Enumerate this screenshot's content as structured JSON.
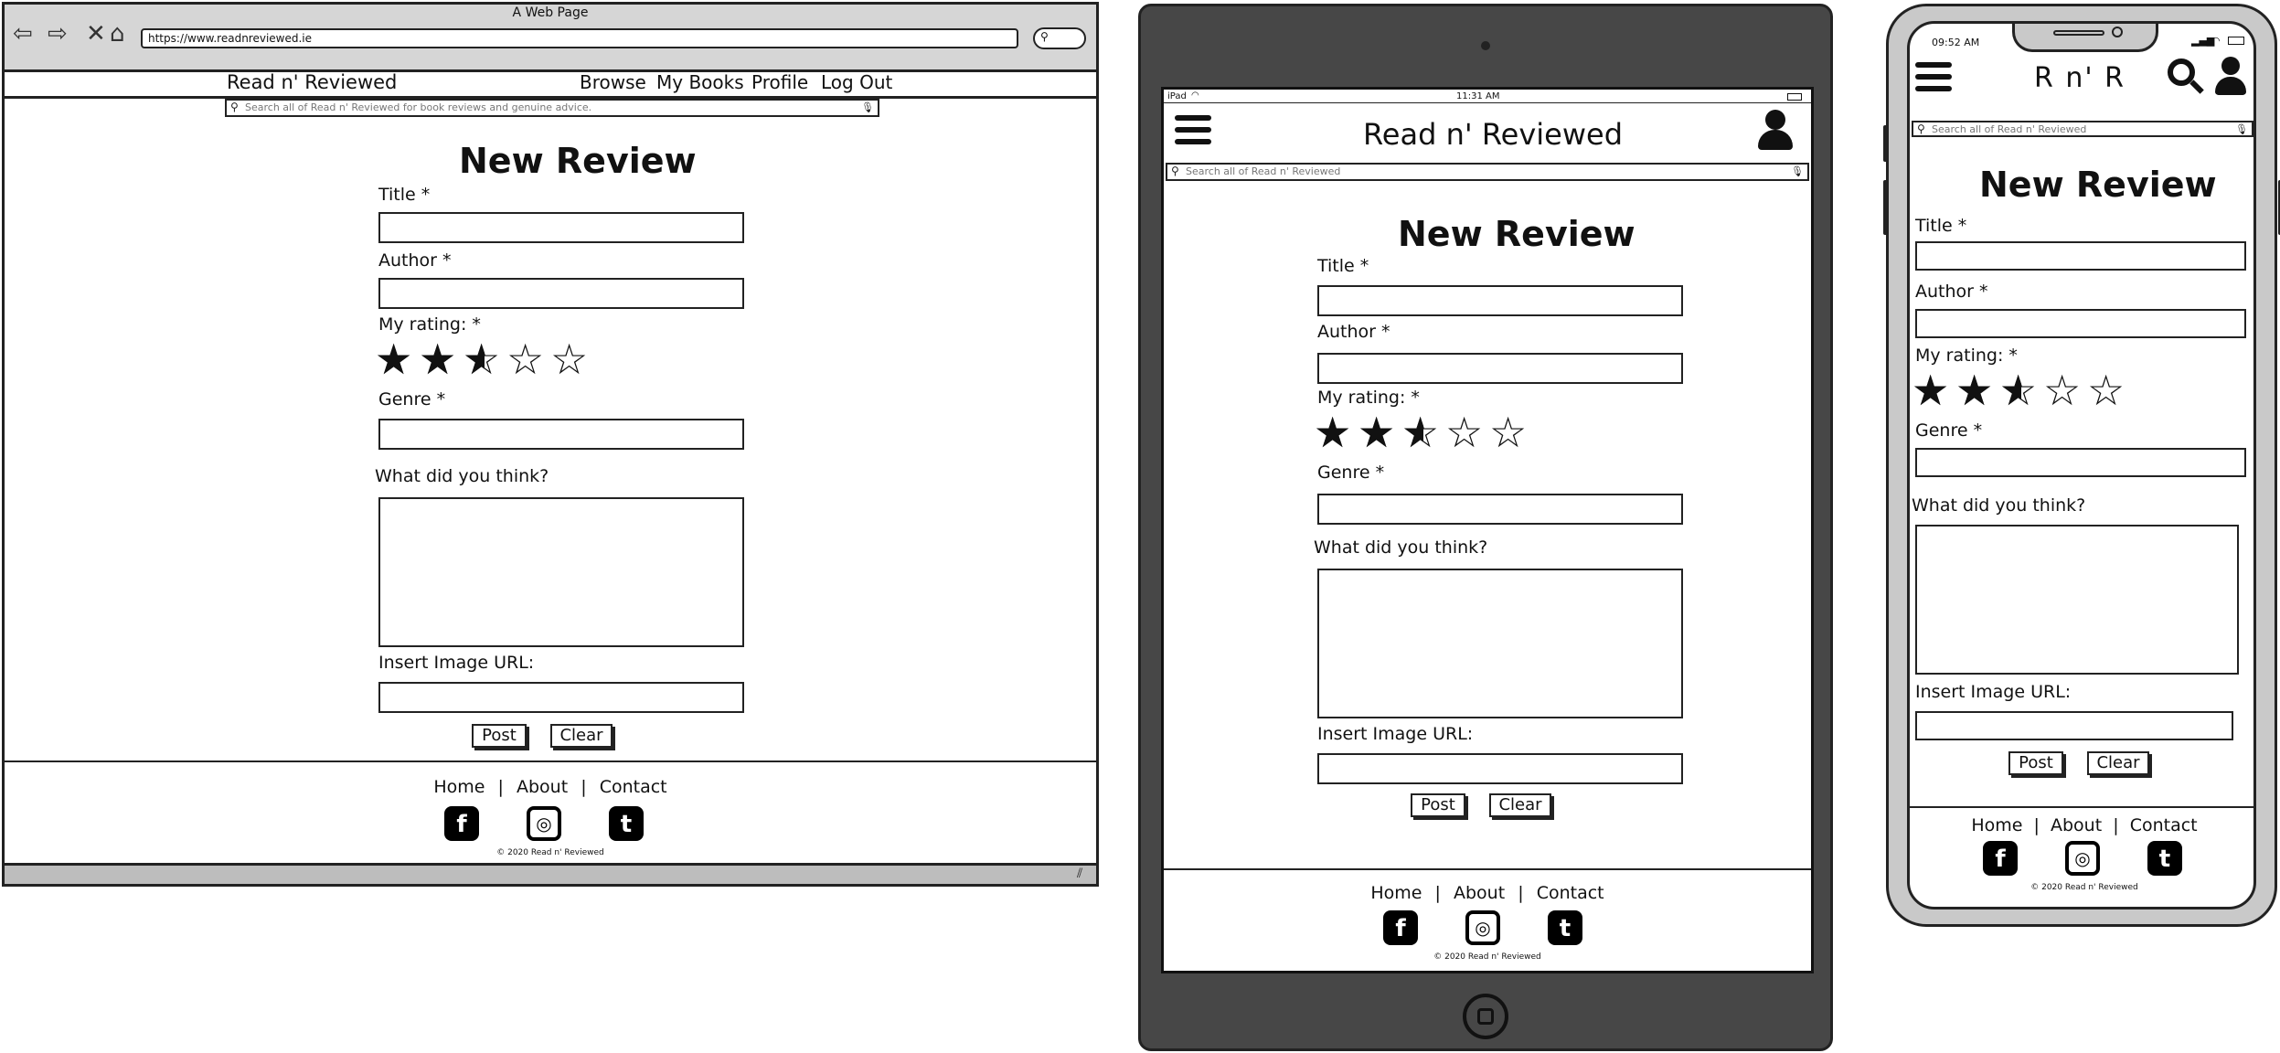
{
  "desktop": {
    "window_title": "A Web Page",
    "url": "https://www.readnreviewed.ie",
    "brand": "Read n' Reviewed",
    "nav": [
      "Browse",
      "My Books",
      "Profile",
      "Log Out"
    ],
    "search_placeholder": "Search all of Read n' Reviewed for book reviews and genuine advice."
  },
  "tablet": {
    "status_left": "iPad",
    "status_time": "11:31 AM",
    "brand": "Read n' Reviewed",
    "search_placeholder": "Search all of Read n' Reviewed"
  },
  "phone": {
    "status_time": "09:52 AM",
    "brand": "R n' R",
    "search_placeholder": "Search all of Read n' Reviewed"
  },
  "form": {
    "heading": "New Review",
    "title_label": "Title *",
    "author_label": "Author *",
    "rating_label": "My rating: *",
    "rating_value": 2.5,
    "rating_max": 5,
    "genre_label": "Genre *",
    "thoughts_label": "What did you think?",
    "image_label": "Insert Image URL:",
    "post_button": "Post",
    "clear_button": "Clear"
  },
  "footer": {
    "home": "Home",
    "about": "About",
    "contact": "Contact",
    "separator": "|",
    "copyright": "© 2020 Read n' Reviewed"
  },
  "icons": {
    "facebook": "f",
    "twitter": "t",
    "instagram": "◎"
  }
}
